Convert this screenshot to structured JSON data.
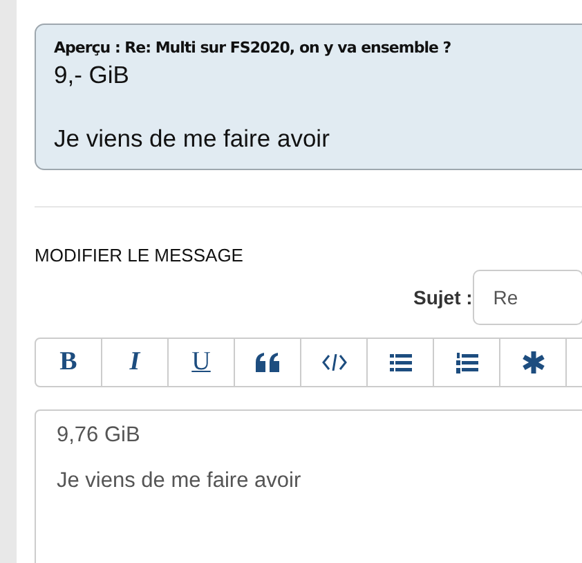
{
  "preview": {
    "title": "Aperçu : Re: Multi sur FS2020, on y va ensemble ?",
    "paragraphs": [
      "9,- GiB",
      "Je viens de me faire avoir"
    ]
  },
  "editor": {
    "heading": "MODIFIER LE MESSAGE",
    "subject_label": "Sujet :",
    "subject_value": "Re",
    "toolbar": [
      {
        "kind": "bold",
        "label": "B"
      },
      {
        "kind": "italic",
        "label": "I"
      },
      {
        "kind": "underline",
        "label": "U"
      },
      {
        "kind": "quote"
      },
      {
        "kind": "code"
      },
      {
        "kind": "list"
      },
      {
        "kind": "numbered-list"
      },
      {
        "kind": "asterisk"
      },
      {
        "kind": "blank"
      }
    ],
    "message": "9,76 GiB\n\nJe viens de me faire avoir"
  }
}
